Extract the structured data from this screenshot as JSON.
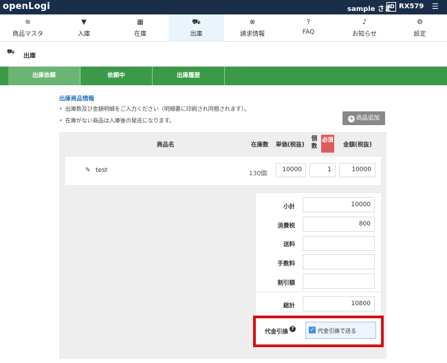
{
  "topbar": {
    "logo": "openLogi",
    "user": "sample さま",
    "id_badge": "ID",
    "user_id": "RX579",
    "menu_icon": "menu-icon"
  },
  "nav": [
    {
      "label": "商品マスタ",
      "icon": "≋"
    },
    {
      "label": "入庫",
      "icon": "▼"
    },
    {
      "label": "在庫",
      "icon": "▦"
    },
    {
      "label": "出庫",
      "icon": "⛟"
    },
    {
      "label": "請求情報",
      "icon": "⊗"
    },
    {
      "label": "FAQ",
      "icon": "?"
    },
    {
      "label": "お知らせ",
      "icon": "♪"
    },
    {
      "label": "設定",
      "icon": "⚙"
    }
  ],
  "page": {
    "title": "出庫",
    "icon": "⛟"
  },
  "tabs": [
    "出庫依頼",
    "依頼中",
    "出庫履歴"
  ],
  "info": {
    "title": "出庫商品情報",
    "bullets": [
      "出庫数及び金額明細をご入力ください（明細書に印刷され同梱されます）。",
      "在庫がない商品は入庫後の発送になります。"
    ],
    "add_button": "商品追加"
  },
  "table": {
    "headers": {
      "name": "商品名",
      "stock": "在庫数",
      "unit_price": "単価(税抜)",
      "quantity": "個数",
      "required": "必須",
      "amount": "金額(税抜)"
    },
    "rows": [
      {
        "name": "test",
        "stock": "130個",
        "unit_price": "10000",
        "quantity": "1",
        "amount": "10000"
      }
    ]
  },
  "totals": {
    "subtotal_label": "小計",
    "subtotal": "10000",
    "tax_label": "消費税",
    "tax": "800",
    "shipping_label": "送料",
    "shipping": "",
    "fee_label": "手数料",
    "fee": "",
    "discount_label": "割引額",
    "discount": "",
    "total_label": "総計",
    "total": "10800"
  },
  "cod": {
    "label": "代金引換",
    "checkbox_label": "代金引換で送る",
    "checked": true
  }
}
